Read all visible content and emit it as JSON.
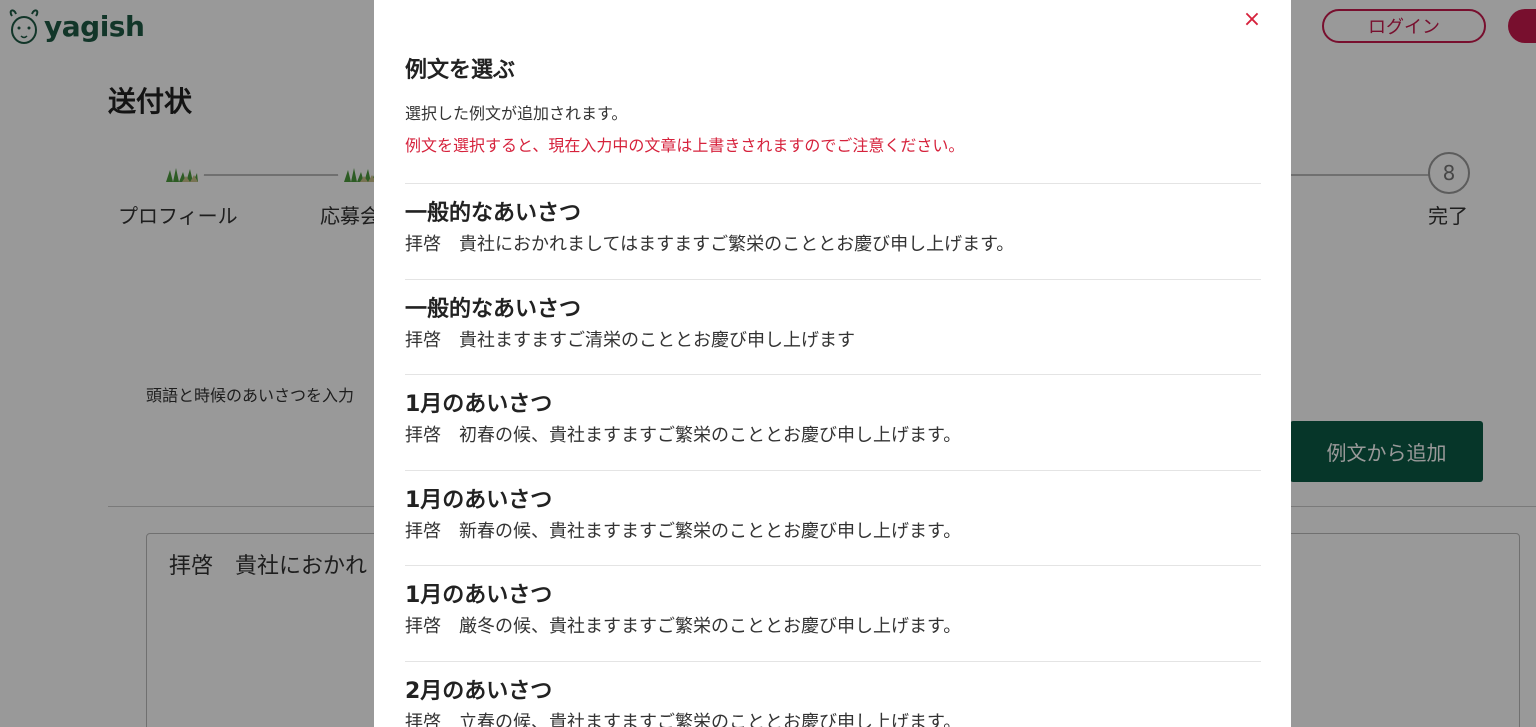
{
  "header": {
    "logo_text": "yagish",
    "login_label": "ログイン"
  },
  "page": {
    "title": "送付状",
    "instruction": "頭語と時候のあいさつを入力",
    "add_sample_label": "例文から追加",
    "body_preview": "拝啓　貴社におかれ"
  },
  "steps": [
    {
      "label": "プロフィール"
    },
    {
      "label": "応募会"
    },
    {
      "number": "8",
      "label": "完了"
    }
  ],
  "modal": {
    "close_symbol": "×",
    "title": "例文を選ぶ",
    "description": "選択した例文が追加されます。",
    "warning": "例文を選択すると、現在入力中の文章は上書きされますのでご注意ください。",
    "items": [
      {
        "title": "一般的なあいさつ",
        "text": "拝啓　貴社におかれましてはますますご繁栄のこととお慶び申し上げます。"
      },
      {
        "title": "一般的なあいさつ",
        "text": "拝啓　貴社ますますご清栄のこととお慶び申し上げます"
      },
      {
        "title": "1月のあいさつ",
        "text": "拝啓　初春の候、貴社ますますご繁栄のこととお慶び申し上げます。"
      },
      {
        "title": "1月のあいさつ",
        "text": "拝啓　新春の候、貴社ますますご繁栄のこととお慶び申し上げます。"
      },
      {
        "title": "1月のあいさつ",
        "text": "拝啓　厳冬の候、貴社ますますご繁栄のこととお慶び申し上げます。"
      },
      {
        "title": "2月のあいさつ",
        "text": "拝啓　立春の候、貴社ますますご繁栄のこととお慶び申し上げます。"
      }
    ]
  },
  "colors": {
    "brand_green": "#0b5a45",
    "accent_red": "#d6223c",
    "login_pink": "#c8194e"
  }
}
